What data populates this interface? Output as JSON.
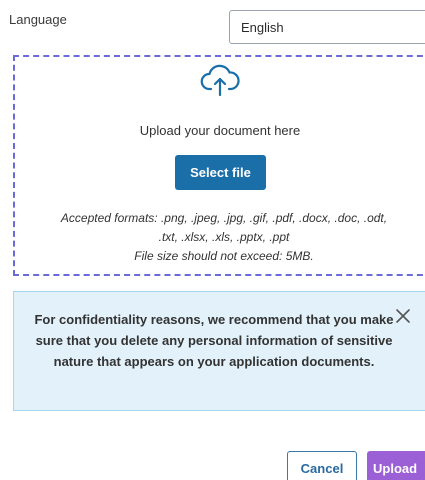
{
  "language": {
    "label": "Language",
    "selected": "English"
  },
  "dropzone": {
    "icon": "cloud-upload-icon",
    "prompt": "Upload your document here",
    "select_label": "Select file",
    "formats_line1": "Accepted formats: .png, .jpeg, .jpg, .gif, .pdf, .docx, .doc, .odt,",
    "formats_line2": ".txt, .xlsx, .xls, .pptx, .ppt",
    "size_limit": "File size should not exceed: 5MB.",
    "border_color": "#6a6ad8"
  },
  "notice": {
    "text": "For confidentiality reasons, we recommend that you make sure that you delete any personal information of sensitive nature that appears on your application documents.",
    "close_icon": "close-icon",
    "background": "#e3f2fa"
  },
  "actions": {
    "cancel_label": "Cancel",
    "upload_label": "Upload"
  },
  "colors": {
    "primary_button": "#1a6fa8",
    "upload_button": "#9b5fd6"
  }
}
